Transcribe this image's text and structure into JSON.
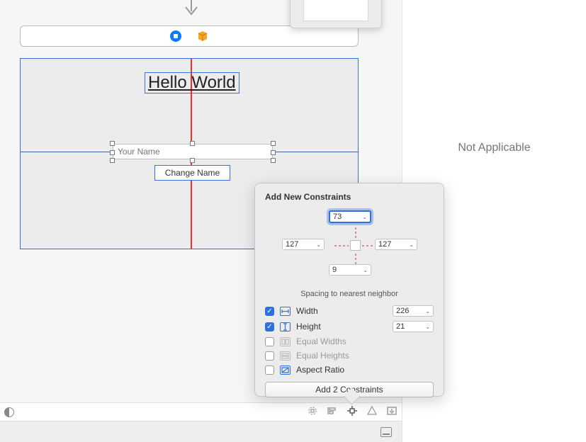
{
  "canvas": {
    "title_label": "Hello World",
    "textfield_placeholder": "Your Name",
    "change_button": "Change Name"
  },
  "right_panel": {
    "empty_text": "Not Applicable"
  },
  "constraints_popover": {
    "title": "Add New Constraints",
    "spacing": {
      "top": "73",
      "left": "127",
      "right": "127",
      "bottom": "9",
      "note": "Spacing to nearest neighbor"
    },
    "dims": {
      "width_label": "Width",
      "width_value": "226",
      "height_label": "Height",
      "height_value": "21"
    },
    "options": {
      "equal_widths": "Equal Widths",
      "equal_heights": "Equal Heights",
      "aspect_ratio": "Aspect Ratio"
    },
    "submit": "Add 2 Constraints"
  }
}
